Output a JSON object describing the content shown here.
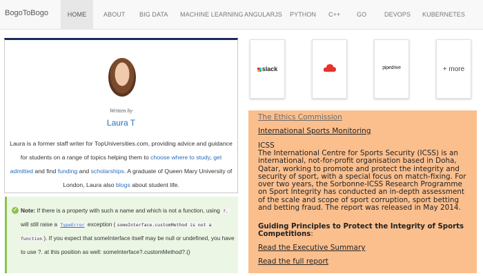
{
  "brand": "BogoToBogo",
  "nav": {
    "items": [
      "HOME",
      "ABOUT",
      "BIG DATA",
      "MACHINE LEARNING",
      "ANGULARJS",
      "PYTHON",
      "C++",
      "GO",
      "DEVOPS",
      "KUBERNETES"
    ],
    "active": "HOME"
  },
  "author": {
    "written_by": "Written by",
    "name": "Laura T",
    "bio": {
      "t1": "Laura is a former staff writer for TopUniversities.com, providing advice and guidance for students on a range of topics helping them to ",
      "l1": "choose where to study",
      "t2": ", ",
      "l2": "get admitted",
      "t3": " and find ",
      "l3": "funding",
      "t4": " and ",
      "l4": "scholarships",
      "t5": ". A graduate of Queen Mary University of London, Laura also ",
      "l5": "blogs",
      "t6": " about student life."
    }
  },
  "note": {
    "icon": "check",
    "label": "Note:",
    "t1": " If there is a property with such a name and which is not a function, using ",
    "c1": "?.",
    "t2": " will still raise a ",
    "c2": "TypeError",
    "t3": " exception (",
    "c3": "someInterface.customMethod is not a function",
    "t4": "). If you expect that someInterface itself may be null or undefined, you have to use ?. at this position as well: someInterface?.customMethod?.()"
  },
  "partners": {
    "slack": "slack",
    "cloud_icon": "red-cloud-logo",
    "pipedrive": "pipedrive",
    "more": "+ more"
  },
  "ethics": {
    "link1": "The Ethics Commission",
    "link2": "International Sports Monitoring",
    "heading": "ICSS",
    "body": "The International Centre for Sports Security (ICSS) is an international, not-for-profit organisation based in Doha, Qatar, working to promote and protect the integrity and security of sport, with a special focus on match-fixing. For over two years, the Sorbonne-ICSS Research Programme on Sport Integrity has conducted an in-depth assessment of the scale and scope of sport corruption, sport betting and betting fraud. The report was released in May 2014.",
    "principles": "Guiding Principles to Protect the Integrity of Sports Competitions",
    "principles_suffix": ":",
    "link3": "Read the Executive Summary",
    "link4": "Read the full report"
  },
  "colors": {
    "link": "#2a6ebb",
    "ethics_bg": "#fbbf8e",
    "note_bg": "#ecf6e4",
    "note_accent": "#8bc34a",
    "panel_top": "#1a2b5a"
  }
}
